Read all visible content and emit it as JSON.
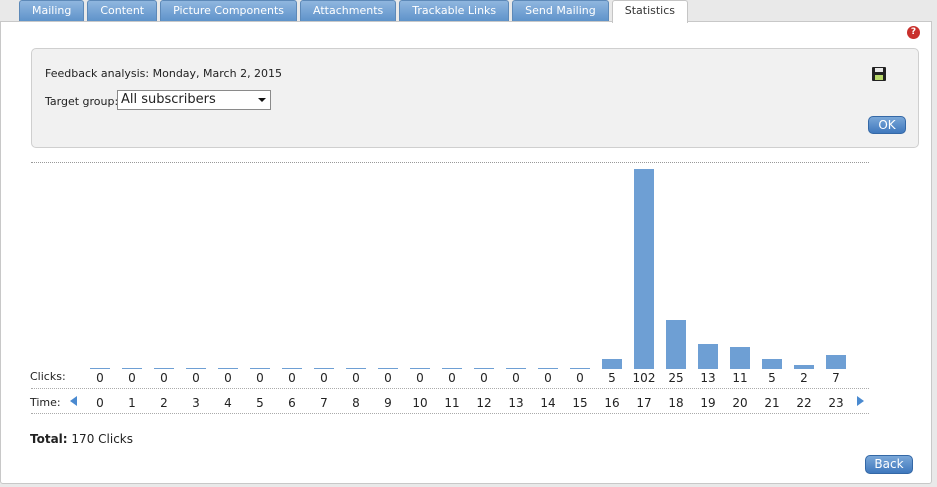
{
  "tabs": [
    {
      "label": "Mailing"
    },
    {
      "label": "Content"
    },
    {
      "label": "Picture Components"
    },
    {
      "label": "Attachments"
    },
    {
      "label": "Trackable Links"
    },
    {
      "label": "Send Mailing"
    },
    {
      "label": "Statistics",
      "active": true
    }
  ],
  "filter": {
    "feedback_label": "Feedback analysis: Monday, March 2, 2015",
    "target_label": "Target group:",
    "target_value": "All subscribers",
    "ok_label": "OK"
  },
  "chart_data": {
    "type": "bar",
    "row_labels": {
      "clicks": "Clicks:",
      "time": "Time:"
    },
    "categories": [
      "0",
      "1",
      "2",
      "3",
      "4",
      "5",
      "6",
      "7",
      "8",
      "9",
      "10",
      "11",
      "12",
      "13",
      "14",
      "15",
      "16",
      "17",
      "18",
      "19",
      "20",
      "21",
      "22",
      "23"
    ],
    "values": [
      0,
      0,
      0,
      0,
      0,
      0,
      0,
      0,
      0,
      0,
      0,
      0,
      0,
      0,
      0,
      0,
      5,
      102,
      25,
      13,
      11,
      5,
      2,
      7
    ],
    "ylim": [
      0,
      102
    ],
    "grid": false
  },
  "total": {
    "label": "Total:",
    "value": "170 Clicks"
  },
  "back_label": "Back",
  "colors": {
    "tab": "#6b9dd2",
    "bar": "#6e9fd4",
    "button": "#4a80c2"
  }
}
